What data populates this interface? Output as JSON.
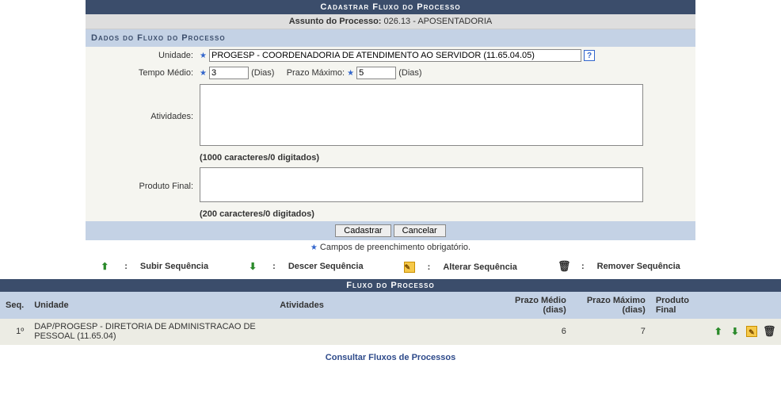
{
  "header": {
    "title": "Cadastrar Fluxo do Processo",
    "assunto_label": "Assunto do Processo:",
    "assunto_value": "026.13 - APOSENTADORIA"
  },
  "section": {
    "title": "Dados do Fluxo do Processo",
    "unidade_label": "Unidade:",
    "unidade_value": "PROGESP - COORDENADORIA DE ATENDIMENTO AO SERVIDOR (11.65.04.05)",
    "tempo_medio_label": "Tempo Médio:",
    "tempo_medio_value": "3",
    "dias_label": "(Dias)",
    "prazo_maximo_label": "Prazo Máximo:",
    "prazo_maximo_value": "5",
    "atividades_label": "Atividades:",
    "atividades_value": "",
    "atividades_counter": "(1000 caracteres/0 digitados)",
    "produto_final_label": "Produto Final:",
    "produto_final_value": "",
    "produto_final_counter": "(200 caracteres/0 digitados)"
  },
  "buttons": {
    "cadastrar": "Cadastrar",
    "cancelar": "Cancelar"
  },
  "required_note": "Campos de preenchimento obrigatório.",
  "legend": {
    "subir": "Subir Sequência",
    "descer": "Descer Sequência",
    "alterar": "Alterar Sequência",
    "remover": "Remover Sequência"
  },
  "grid": {
    "title": "Fluxo do Processo",
    "columns": {
      "seq": "Seq.",
      "unidade": "Unidade",
      "atividades": "Atividades",
      "prazo_medio": "Prazo Médio (dias)",
      "prazo_maximo": "Prazo Máximo (dias)",
      "produto_final": "Produto Final"
    },
    "rows": [
      {
        "seq": "1º",
        "unidade": "DAP/PROGESP - DIRETORIA DE ADMINISTRACAO DE PESSOAL (11.65.04)",
        "atividades": "",
        "prazo_medio": "6",
        "prazo_maximo": "7",
        "produto_final": ""
      }
    ]
  },
  "footer_link": "Consultar Fluxos de Processos",
  "icons": {
    "help": "?",
    "star": "★",
    "arrow_up": "⬆",
    "arrow_down": "⬇",
    "edit": "✎",
    "remove": "🗑"
  }
}
